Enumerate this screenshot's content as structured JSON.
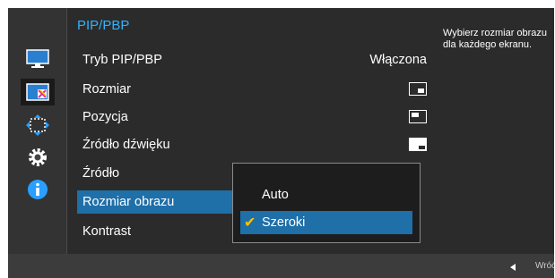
{
  "menu": {
    "title": "PIP/PBP",
    "items": [
      {
        "label": "Tryb PIP/PBP",
        "value": "Włączona"
      },
      {
        "label": "Rozmiar",
        "value_icon": "pip-size-icon"
      },
      {
        "label": "Pozycja",
        "value_icon": "pip-position-icon"
      },
      {
        "label": "Źródło dźwięku",
        "value_icon": "sound-source-icon"
      },
      {
        "label": "Źródło"
      },
      {
        "label": "Rozmiar obrazu",
        "selected": true
      },
      {
        "label": "Kontrast"
      }
    ]
  },
  "nav_icons": [
    {
      "name": "picture-icon"
    },
    {
      "name": "pip-pbp-icon",
      "active": true
    },
    {
      "name": "position-arrows-icon"
    },
    {
      "name": "settings-gear-icon"
    },
    {
      "name": "info-icon"
    }
  ],
  "popup": {
    "options": [
      {
        "label": "Auto",
        "selected": false
      },
      {
        "label": "Szeroki",
        "selected": true
      }
    ]
  },
  "help": {
    "text": "Wybierz rozmiar obrazu dla każdego ekranu."
  },
  "footer": {
    "return_label": "Wróć"
  },
  "colors": {
    "accent": "#2fb3ff",
    "highlight": "#1f6fa8",
    "check": "#ffc200",
    "background": "#2b2b2b"
  }
}
